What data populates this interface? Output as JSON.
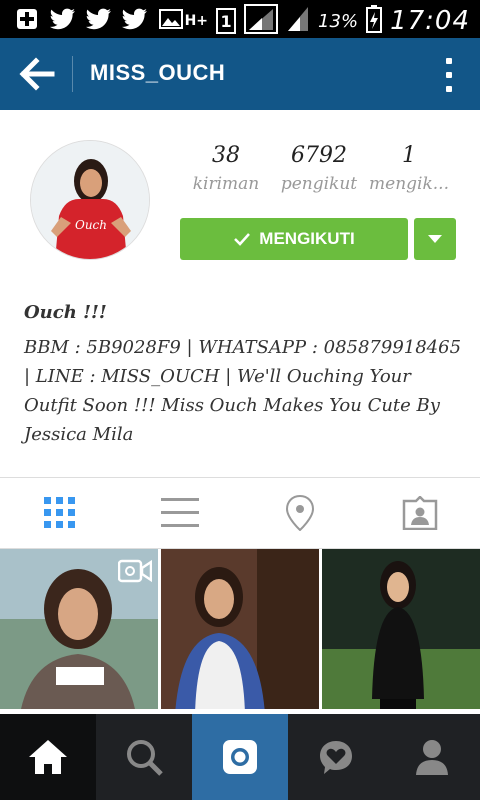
{
  "status_bar": {
    "icons_left": [
      "add-icon",
      "twitter-icon",
      "twitter-icon",
      "twitter-icon",
      "gallery-icon"
    ],
    "network": "H+",
    "sim_slot": "1",
    "battery_percent": "13%",
    "time": "17:04"
  },
  "app_bar": {
    "title": "MISS_OUCH"
  },
  "profile": {
    "stats": [
      {
        "value": "38",
        "label": "kiriman"
      },
      {
        "value": "6792",
        "label": "pengikut"
      },
      {
        "value": "1",
        "label": "mengik..."
      }
    ],
    "follow_button_label": "MENGIKUTI",
    "bio_name": "Ouch !!!",
    "bio_text": "BBM : 5B9028F9 | WHATSAPP : 085879918465 | LINE : MISS_OUCH | We'll Ouching Your Outfit Soon !!! Miss Ouch Makes You Cute By Jessica Mila"
  },
  "tabs": [
    "grid-view-icon",
    "list-view-icon",
    "location-pin-icon",
    "tagged-photos-icon"
  ],
  "bottom_nav": [
    "home-icon",
    "search-icon",
    "camera-icon",
    "activity-icon",
    "profile-icon"
  ],
  "colors": {
    "app_bar": "#125688",
    "follow_green": "#6bbd3e",
    "active_tab": "#3897f0",
    "bottom_nav_bg": "#1f2124",
    "camera_tab": "#2e6da4"
  }
}
